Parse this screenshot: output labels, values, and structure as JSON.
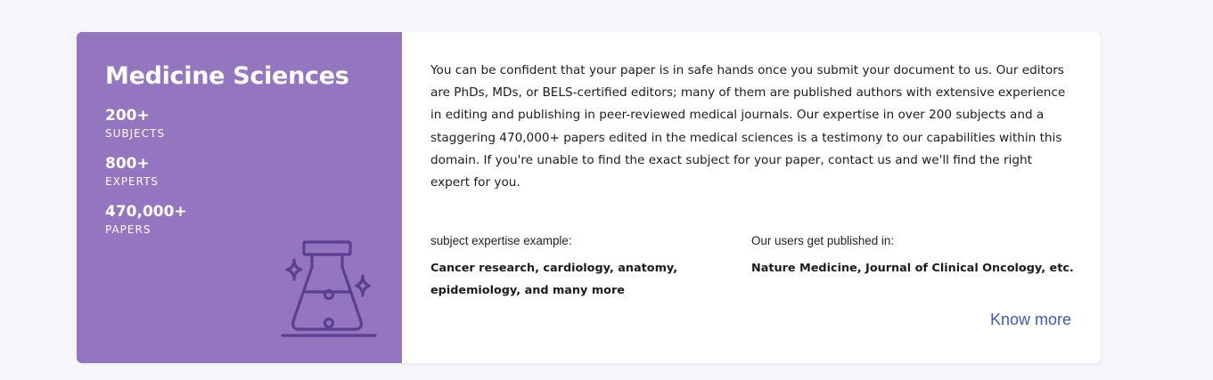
{
  "card": {
    "title": "Medicine Sciences",
    "stats": [
      {
        "value": "200+",
        "label": "SUBJECTS"
      },
      {
        "value": "800+",
        "label": "EXPERTS"
      },
      {
        "value": "470,000+",
        "label": "PAPERS"
      }
    ],
    "icon": "flask-icon",
    "description": "You can be confident that your paper is in safe hands once you submit your document to us. Our editors are PhDs, MDs, or BELS-certified editors; many of them are published authors with extensive experience in editing and publishing in peer-reviewed medical journals. Our expertise in over 200 subjects and a staggering 470,000+ papers edited in the medical sciences is a testimony to our capabilities within this domain. If you're unable to find the exact subject for your paper, contact us and we'll find the right expert for you.",
    "expertise": {
      "heading": "subject expertise example:",
      "text": "Cancer research, cardiology, anatomy, epidemiology, and many more"
    },
    "published": {
      "heading": "Our users get published in:",
      "text": "Nature Medicine, Journal of Clinical Oncology, etc."
    },
    "know_more_label": "Know more"
  },
  "colors": {
    "panel": "#9475bf",
    "icon_stroke": "#5b3f91",
    "link": "#3f5bb7",
    "background": "#f5f5fa"
  }
}
